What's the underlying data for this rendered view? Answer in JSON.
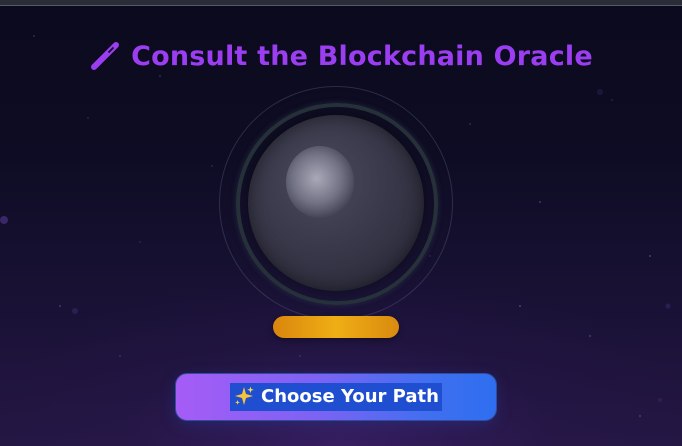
{
  "header": {
    "title": "Consult the Blockchain Oracle",
    "title_icon": "magic-wand-icon",
    "title_color": "#9b3df0"
  },
  "oracle": {
    "orb_icon": "crystal-ball",
    "base_color": "#efae15"
  },
  "action": {
    "label": "Choose Your Path",
    "icon": "sparkles-icon",
    "gradient_start": "#a65cf6",
    "gradient_end": "#2f6ef0"
  }
}
